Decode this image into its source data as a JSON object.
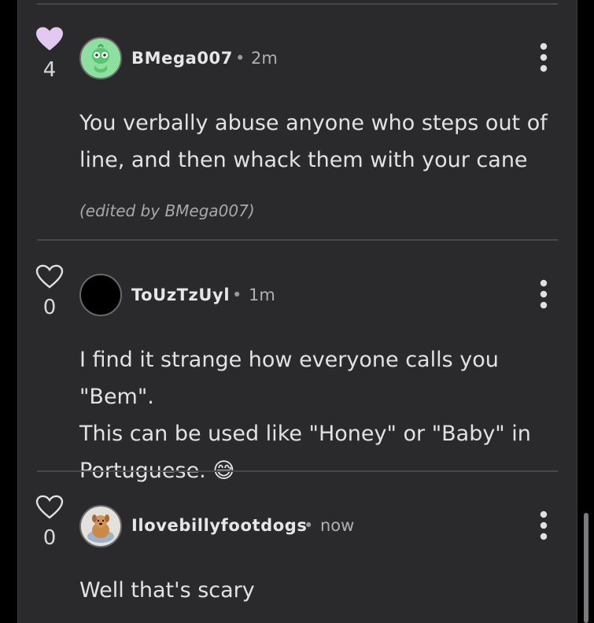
{
  "comments": [
    {
      "like_count": "4",
      "liked": true,
      "username": "BMega007",
      "separator": "•",
      "time": "2m",
      "body": "You verbally abuse anyone who steps out of line, and then whack them with your cane",
      "edited_note": "(edited by BMega007)",
      "avatar": "green-cartoon-avatar"
    },
    {
      "like_count": "0",
      "liked": false,
      "username": "ToUzTzUyl",
      "separator": "•",
      "time": "1m",
      "body_line1": "I find it strange how everyone calls you \"Bem\".",
      "body_line2": "This can be used like \"Honey\" or \"Baby\" in",
      "body_line3": "Portuguese.",
      "emoji": "😅",
      "avatar": "black-circle-avatar"
    },
    {
      "like_count": "0",
      "liked": false,
      "username": "Ilovebillyfootdogs",
      "separator": "•",
      "time": "now",
      "body": "Well that's scary",
      "avatar": "dog-photo-avatar"
    }
  ],
  "colors": {
    "liked_heart": "#e3c8f2",
    "panel_bg": "#2a2a2c",
    "avatar_green": "#8fe0a0"
  },
  "icons": {
    "like_filled": "heart-filled-icon",
    "like_outline": "heart-outline-icon",
    "menu": "vertical-ellipsis-icon"
  }
}
